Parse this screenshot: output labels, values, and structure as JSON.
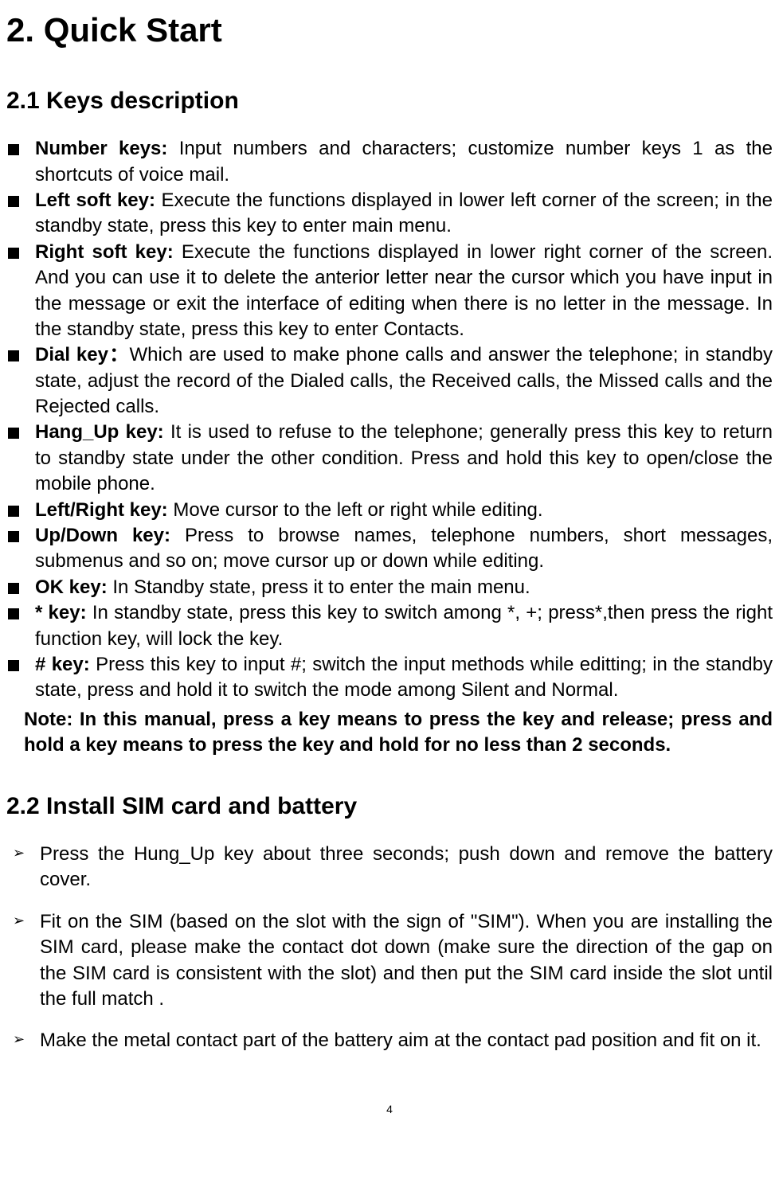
{
  "title": "2. Quick Start",
  "sections": [
    {
      "heading": "2.1 Keys description",
      "items": [
        {
          "label": "Number keys:",
          "text": " Input numbers and characters; customize number keys 1 as the shortcuts of voice mail."
        },
        {
          "label": "Left soft key:",
          "text": " Execute the functions displayed in lower left corner of the screen; in the standby state, press this key to enter main menu."
        },
        {
          "label": "Right soft key:",
          "text": " Execute the functions displayed in lower right corner of the screen. And you can use it to delete the anterior letter near the cursor which you have input in the message or exit the interface of editing when there is no letter in the message. In the standby state, press this key to enter Contacts."
        },
        {
          "label": "Dial key：",
          "text": "Which are used to make phone calls and answer the telephone; in standby state, adjust the record of the Dialed calls, the Received calls, the Missed calls and the Rejected calls."
        },
        {
          "label": "Hang_Up key:",
          "text": " It is used to refuse to the telephone; generally press this key to return to standby state under the other condition. Press and hold this key to open/close the mobile phone."
        },
        {
          "label": "Left/Right key:",
          "text": " Move cursor to the left or right while editing."
        },
        {
          "label": "Up/Down key:",
          "text": " Press to browse names, telephone numbers, short messages, submenus and so on; move cursor up or down while editing."
        },
        {
          "label": "OK key:",
          "text": " In Standby state, press it to enter the main menu."
        },
        {
          "label": "* key:",
          "text": " In standby state, press this key to switch among *, +; press*,then press the right function key, will lock the key."
        },
        {
          "label": "# key:",
          "text": " Press this key to input #; switch the input methods while editting; in the standby state, press and hold it to switch the mode among Silent and Normal."
        }
      ],
      "note": "Note: In this manual, press a key means to press the key and release; press and hold a key means to press the key and hold for no less than 2 seconds."
    },
    {
      "heading": "2.2 Install SIM card and battery",
      "steps": [
        "Press the Hung_Up key about three seconds; push down and remove the battery cover.",
        "Fit on the SIM (based on the slot with the sign of \"SIM\"). When you are installing the SIM card, please make the contact dot down (make sure the direction of the gap on the SIM card is consistent with the slot) and then put the SIM card inside the slot until the full match .",
        "Make the metal contact part of the battery aim at the contact pad position and fit on it."
      ]
    }
  ],
  "page_number": "4"
}
